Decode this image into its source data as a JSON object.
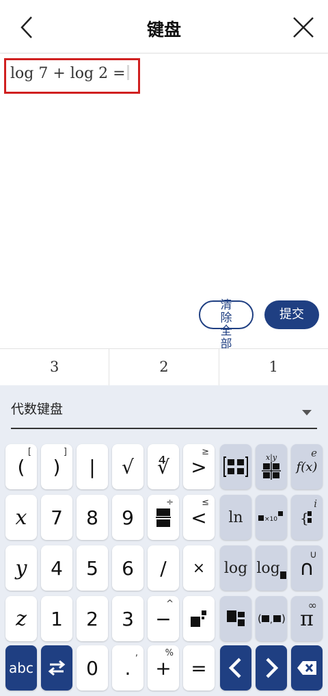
{
  "header": {
    "title": "键盘"
  },
  "editor": {
    "expression": "log 7 + log 2 =",
    "clear_label": "清除全部",
    "submit_label": "提交"
  },
  "suggestions": [
    "3",
    "2",
    "1"
  ],
  "keyboard": {
    "selector_label": "代数键盘",
    "rows": [
      [
        {
          "label": "(",
          "sup": "["
        },
        {
          "label": ")",
          "sup": "]"
        },
        {
          "label": "|"
        },
        {
          "label": "√"
        },
        {
          "label": "∜",
          "note": "nth-root"
        },
        {
          "label": ">",
          "sup": "≥"
        },
        {
          "label": "matrix",
          "icon": "matrix-icon"
        },
        {
          "label": "fraction x|y",
          "icon": "fraction-icon",
          "mini": "x|y"
        },
        {
          "label": "f(x)",
          "sup": "e"
        }
      ],
      [
        {
          "label": "x"
        },
        {
          "label": "7"
        },
        {
          "label": "8"
        },
        {
          "label": "9"
        },
        {
          "label": "fraction",
          "sup": "÷",
          "icon": "fraction-bar-icon"
        },
        {
          "label": "<",
          "sup": "≤"
        },
        {
          "label": "ln"
        },
        {
          "label": "×10",
          "icon": "sci-notation-icon"
        },
        {
          "label": "{",
          "sup": "i",
          "icon": "brace-icon"
        }
      ],
      [
        {
          "label": "y"
        },
        {
          "label": "4"
        },
        {
          "label": "5"
        },
        {
          "label": "6"
        },
        {
          "label": "/"
        },
        {
          "label": "×"
        },
        {
          "label": "log"
        },
        {
          "label": "log",
          "icon": "log-base-icon"
        },
        {
          "label": "∩",
          "sup": "∪"
        }
      ],
      [
        {
          "label": "z"
        },
        {
          "label": "1"
        },
        {
          "label": "2"
        },
        {
          "label": "3"
        },
        {
          "label": "−",
          "sup": "^"
        },
        {
          "label": "power",
          "icon": "power-icon"
        },
        {
          "label": "subscript",
          "icon": "subscript-icon"
        },
        {
          "label": "(■,■)",
          "icon": "pair-icon"
        },
        {
          "label": "π",
          "sup": "∞"
        }
      ],
      [
        {
          "label": "abc"
        },
        {
          "label": "⇆"
        },
        {
          "label": "0"
        },
        {
          "label": ".",
          "sup": ","
        },
        {
          "label": "+",
          "sup": "%"
        },
        {
          "label": "="
        },
        {
          "label": "<",
          "icon": "arrow-left-icon"
        },
        {
          "label": ">",
          "icon": "arrow-right-icon"
        },
        {
          "label": "⌫",
          "icon": "backspace-icon"
        }
      ]
    ]
  },
  "colors": {
    "accent": "#1f3f82",
    "highlight_border": "#d02020",
    "keyboard_bg": "#e9edf4",
    "func_key": "#cfd5e3"
  }
}
